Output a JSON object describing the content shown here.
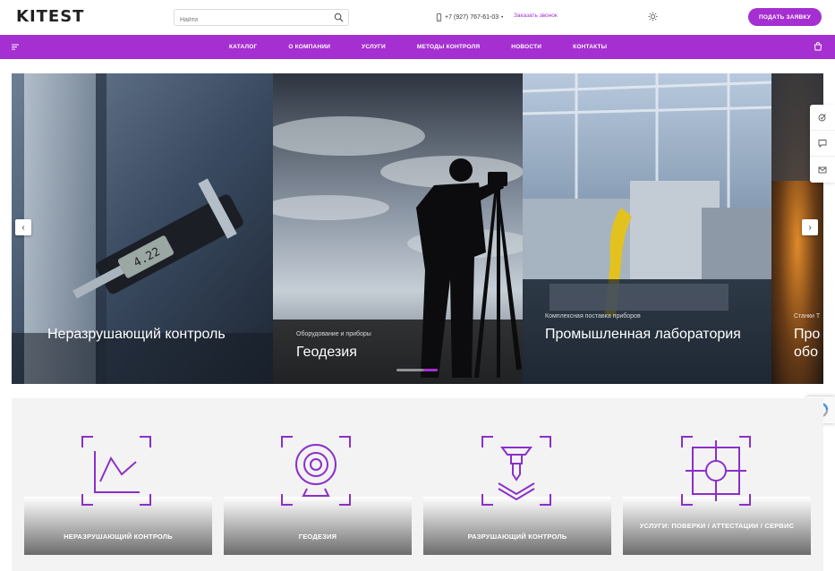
{
  "header": {
    "logo_text": "KITEST",
    "search_placeholder": "Найти",
    "phone": "+7 (927) 767-61-03",
    "callback_link": "Заказать звонок",
    "cta_button": "ПОДАТЬ ЗАЯВКУ"
  },
  "nav": {
    "items": [
      "КАТАЛОГ",
      "О КОМПАНИИ",
      "УСЛУГИ",
      "МЕТОДЫ КОНТРОЛЯ",
      "НОВОСТИ",
      "КОНТАКТЫ"
    ]
  },
  "slider": {
    "slides": [
      {
        "subtitle": "",
        "title": "Неразрушающий контроль"
      },
      {
        "subtitle": "Оборудование и приборы",
        "title": "Геодезия"
      },
      {
        "subtitle": "Комплексная поставка приборов",
        "title": "Промышленная лаборатория"
      },
      {
        "subtitle": "Станки Т",
        "title": "Про обо"
      }
    ],
    "prev_arrow": "‹",
    "next_arrow": "›"
  },
  "categories": [
    {
      "label": "НЕРАЗРУШАЮЩИЙ КОНТРОЛЬ",
      "icon": "chart-frame-icon"
    },
    {
      "label": "ГЕОДЕЗИЯ",
      "icon": "webcam-frame-icon"
    },
    {
      "label": "РАЗРУШАЮЩИЙ КОНТРОЛЬ",
      "icon": "press-frame-icon"
    },
    {
      "label": "УСЛУГИ: ПОВЕРКИ / АТТЕСТАЦИИ / СЕРВИС",
      "icon": "crosshair-frame-icon"
    }
  ],
  "colors": {
    "accent": "#a52fd1"
  }
}
